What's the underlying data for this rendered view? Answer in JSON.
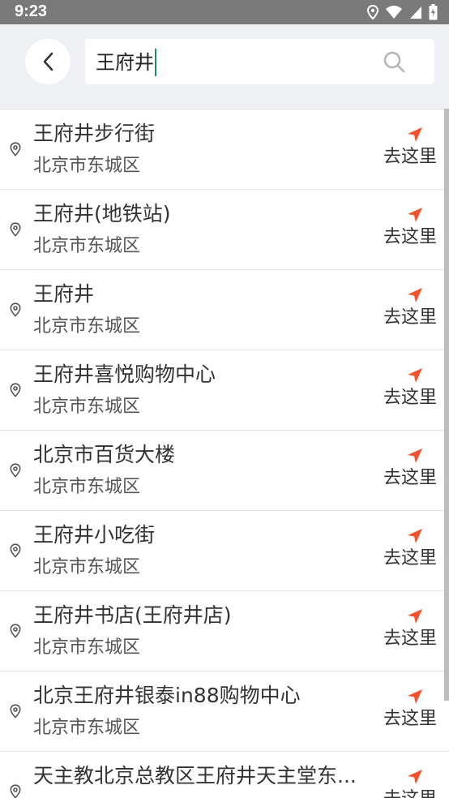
{
  "status_bar": {
    "time": "9:23",
    "icons": [
      "location-icon",
      "wifi-icon",
      "signal-icon",
      "battery-icon"
    ]
  },
  "search": {
    "query": "王府井",
    "icon": "search-icon"
  },
  "colors": {
    "accent_arrow": "#f4522d",
    "caret": "#1a8a7a"
  },
  "results": [
    {
      "title": "王府井步行街",
      "subtitle": "北京市东城区",
      "action": "去这里"
    },
    {
      "title": "王府井(地铁站)",
      "subtitle": "北京市东城区",
      "action": "去这里"
    },
    {
      "title": "王府井",
      "subtitle": "北京市东城区",
      "action": "去这里"
    },
    {
      "title": "王府井喜悦购物中心",
      "subtitle": "北京市东城区",
      "action": "去这里"
    },
    {
      "title": "北京市百货大楼",
      "subtitle": "北京市东城区",
      "action": "去这里"
    },
    {
      "title": "王府井小吃街",
      "subtitle": "北京市东城区",
      "action": "去这里"
    },
    {
      "title": "王府井书店(王府井店)",
      "subtitle": "北京市东城区",
      "action": "去这里"
    },
    {
      "title": "北京王府井银泰in88购物中心",
      "subtitle": "北京市东城区",
      "action": "去这里"
    },
    {
      "title": "天主教北京总教区王府井天主堂东...",
      "subtitle": "",
      "action": "去这里"
    }
  ]
}
